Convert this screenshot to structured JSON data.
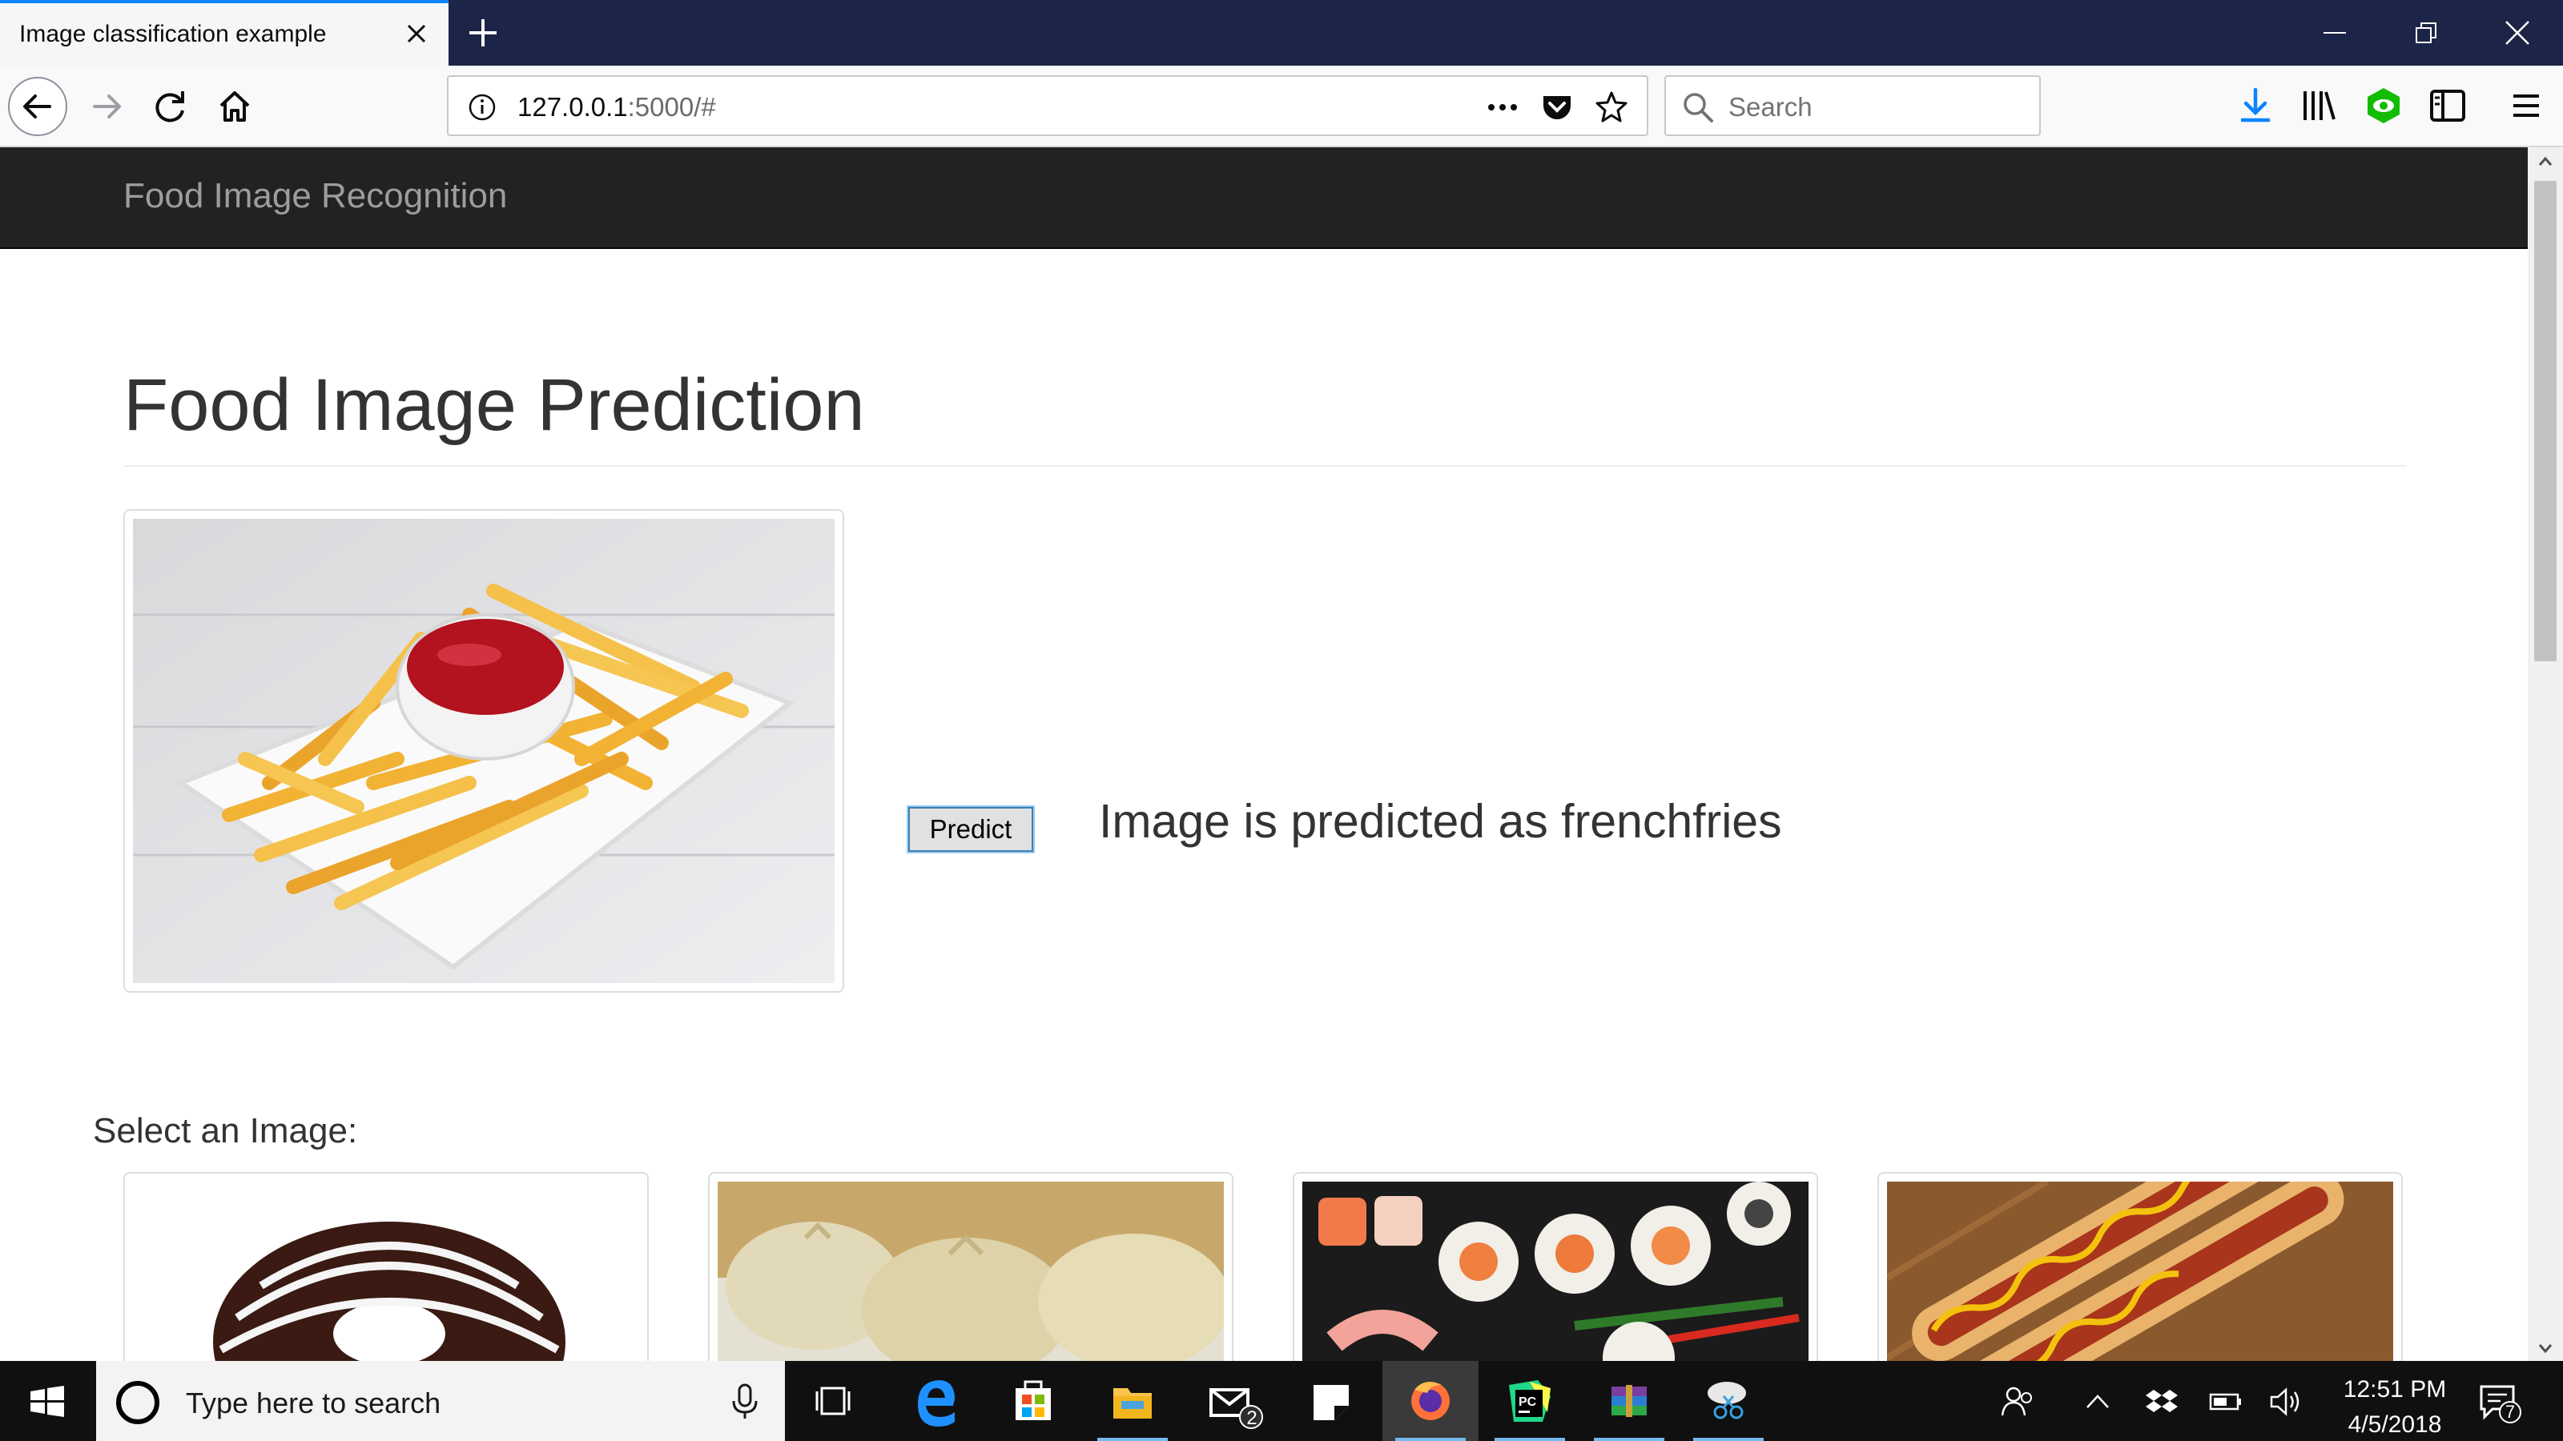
{
  "browser": {
    "tab_title": "Image classification example",
    "url_host": "127.0.0.1",
    "url_rest": ":5000/#",
    "search_placeholder": "Search"
  },
  "site": {
    "brand": "Food Image Recognition",
    "page_title": "Food Image Prediction",
    "predict_label": "Predict",
    "prediction_text": "Image is predicted as frenchfries",
    "select_label": "Select an Image:"
  },
  "gallery": [
    {
      "name": "donut",
      "icon": "donut-photo"
    },
    {
      "name": "dumplings",
      "icon": "dumplings-photo"
    },
    {
      "name": "sushi",
      "icon": "sushi-photo"
    },
    {
      "name": "hotdog",
      "icon": "hotdog-photo"
    }
  ],
  "taskbar": {
    "search_placeholder": "Type here to search",
    "time": "12:51 PM",
    "date": "4/5/2018",
    "mail_badge": "2",
    "notification_count": "7"
  },
  "colors": {
    "firefox_tabbar": "#1c2547",
    "accent": "#0a84ff",
    "site_nav": "#222222",
    "taskbar": "#101010"
  }
}
